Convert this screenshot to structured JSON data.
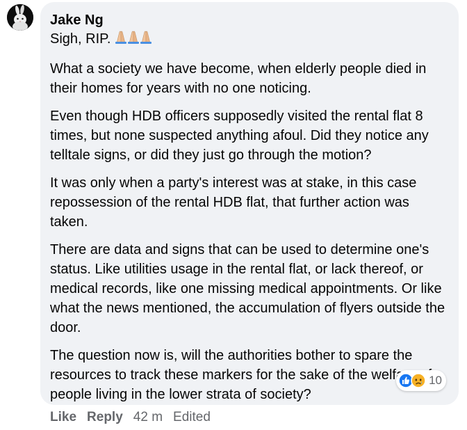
{
  "comment": {
    "author": "Jake Ng",
    "first_line": "Sigh, RIP.",
    "emoji": "folded-hands-emoji x3",
    "paragraphs": [
      "What a society we have become, when elderly people died in their homes for years with no one noticing.",
      "Even though HDB officers supposedly visited the rental flat 8 times, but none suspected anything afoul. Did they notice any telltale signs, or did they just go through the motion?",
      "It was only when a party's interest was at stake, in this case repossession of the rental HDB flat, that further action was taken.",
      "There are data and signs that can be used to determine one's status. Like utilities usage in the rental flat, or lack thereof, or medical records, like one missing medical appointments. Or like what the news mentioned, the accumulation of flyers outside the door.",
      "The question now is, will the authorities bother to spare the resources to track these markers for the sake of the welfare of people living in the lower strata of society?"
    ]
  },
  "reactions": {
    "icons": [
      "like-icon",
      "sad-icon"
    ],
    "count": "10"
  },
  "actions": {
    "like_label": "Like",
    "reply_label": "Reply",
    "time": "42 m",
    "edited": "Edited"
  },
  "colors": {
    "bubble": "#f0f2f5",
    "text": "#050505",
    "muted": "#65676b",
    "like_blue": "#1877f2",
    "sad_yellow": "#f7b125"
  }
}
